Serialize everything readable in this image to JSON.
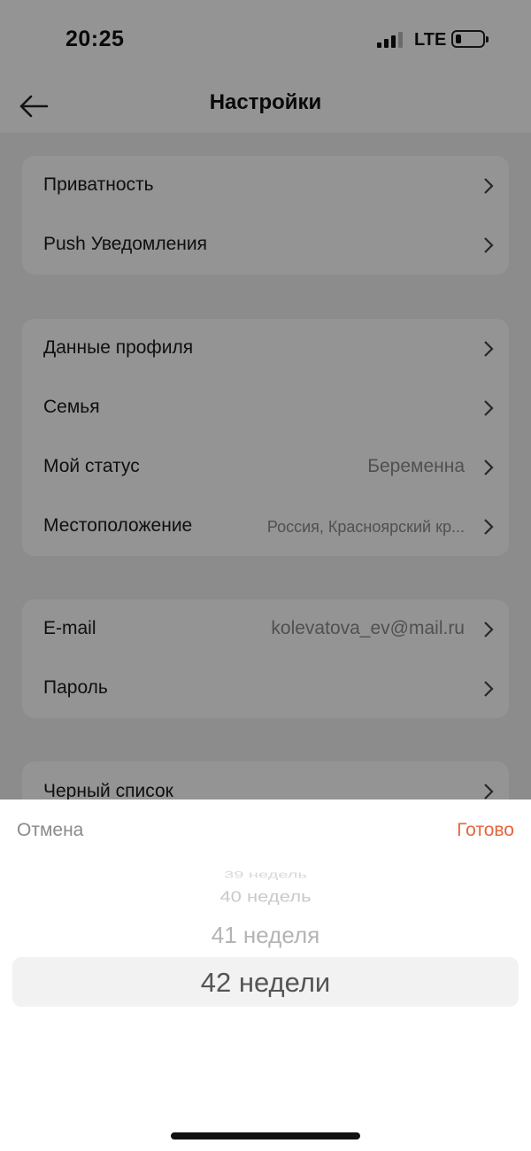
{
  "status_bar": {
    "time": "20:25",
    "network": "LTE"
  },
  "header": {
    "title": "Настройки",
    "back_icon": "arrow-left-icon"
  },
  "groups": [
    {
      "rows": [
        {
          "label": "Приватность",
          "value": ""
        },
        {
          "label": "Push Уведомления",
          "value": ""
        }
      ]
    },
    {
      "rows": [
        {
          "label": "Данные профиля",
          "value": ""
        },
        {
          "label": "Семья",
          "value": ""
        },
        {
          "label": "Мой статус",
          "value": "Беременна"
        },
        {
          "label": "Местоположение",
          "value": "Россия, Красноярский кр..."
        }
      ]
    },
    {
      "rows": [
        {
          "label": "E-mail",
          "value": "kolevatova_ev@mail.ru"
        },
        {
          "label": "Пароль",
          "value": ""
        }
      ]
    },
    {
      "rows": [
        {
          "label": "Черный список",
          "value": ""
        }
      ]
    }
  ],
  "picker_sheet": {
    "cancel_label": "Отмена",
    "done_label": "Готово",
    "options": [
      "39 недель",
      "40 недель",
      "41 неделя"
    ],
    "selected": "42 недели"
  },
  "colors": {
    "accent": "#e8633c",
    "overlay": "rgba(0,0,0,0.42)"
  }
}
